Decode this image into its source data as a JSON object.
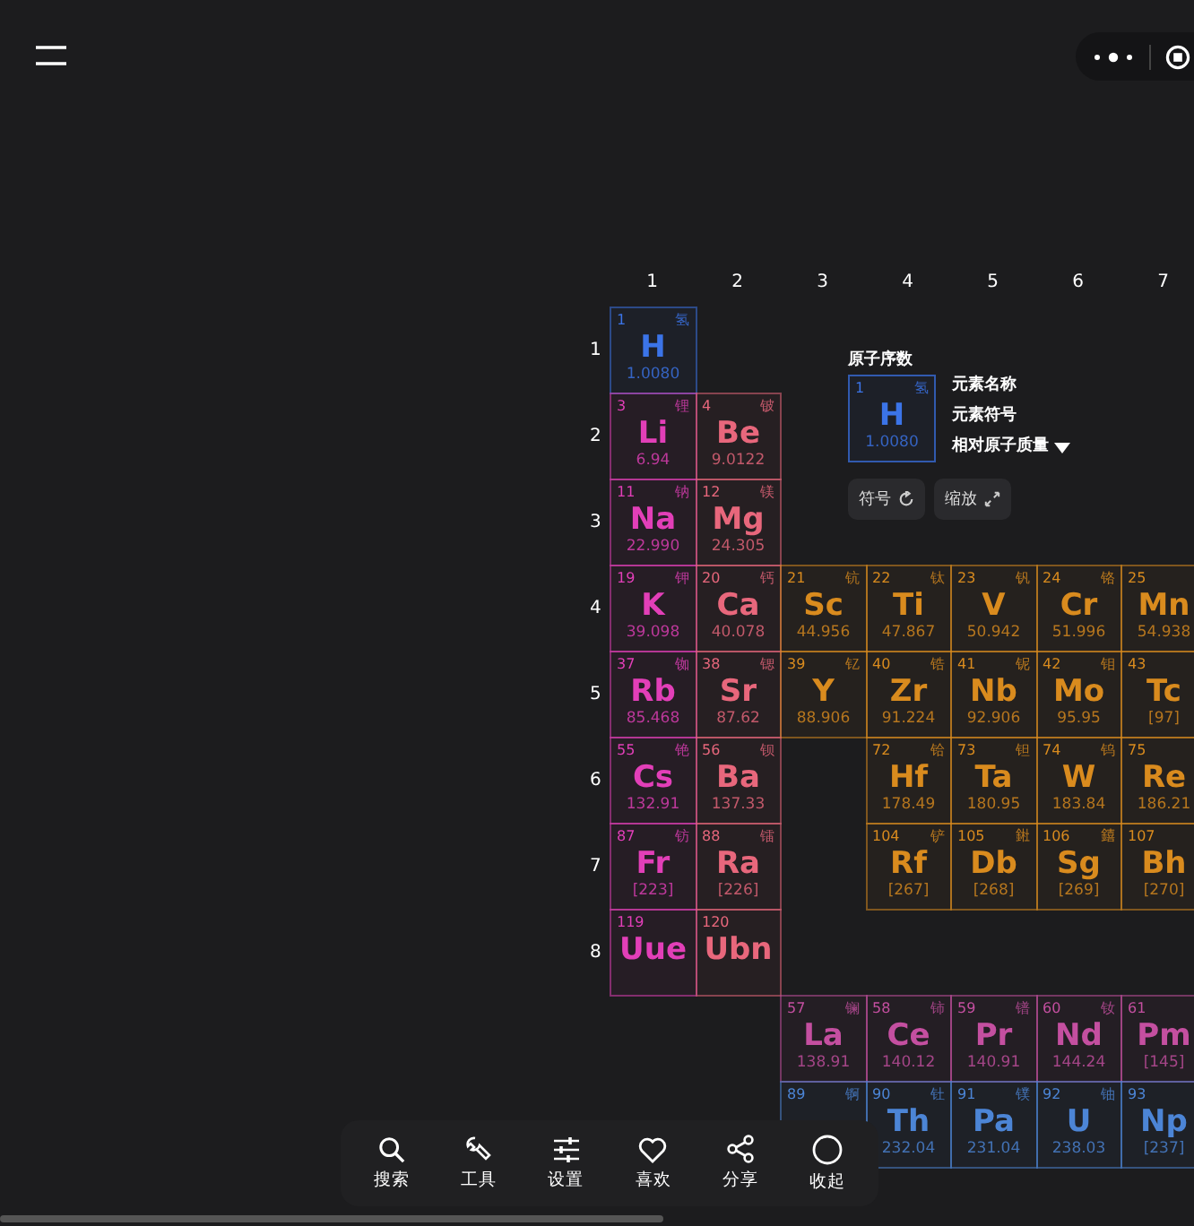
{
  "group_headers": [
    "1",
    "2",
    "3",
    "4",
    "5",
    "6",
    "7"
  ],
  "rows": [
    {
      "label": "1",
      "cells": [
        {
          "kind": "element",
          "number": "1",
          "name": "氢",
          "symbol": "H",
          "mass": "1.0080",
          "color": "#3b74e8"
        }
      ]
    },
    {
      "label": "2",
      "cells": [
        {
          "kind": "element",
          "number": "3",
          "name": "锂",
          "symbol": "Li",
          "mass": "6.94",
          "color": "#e23fb8"
        },
        {
          "kind": "element",
          "number": "4",
          "name": "铍",
          "symbol": "Be",
          "mass": "9.0122",
          "color": "#e8677c"
        }
      ]
    },
    {
      "label": "3",
      "cells": [
        {
          "kind": "element",
          "number": "11",
          "name": "钠",
          "symbol": "Na",
          "mass": "22.990",
          "color": "#e23fb8"
        },
        {
          "kind": "element",
          "number": "12",
          "name": "镁",
          "symbol": "Mg",
          "mass": "24.305",
          "color": "#e8677c"
        }
      ]
    },
    {
      "label": "4",
      "cells": [
        {
          "kind": "element",
          "number": "19",
          "name": "钾",
          "symbol": "K",
          "mass": "39.098",
          "color": "#e23fb8"
        },
        {
          "kind": "element",
          "number": "20",
          "name": "钙",
          "symbol": "Ca",
          "mass": "40.078",
          "color": "#e8677c"
        },
        {
          "kind": "element",
          "number": "21",
          "name": "钪",
          "symbol": "Sc",
          "mass": "44.956",
          "color": "#d98b1e"
        },
        {
          "kind": "element",
          "number": "22",
          "name": "钛",
          "symbol": "Ti",
          "mass": "47.867",
          "color": "#d98b1e"
        },
        {
          "kind": "element",
          "number": "23",
          "name": "钒",
          "symbol": "V",
          "mass": "50.942",
          "color": "#d98b1e"
        },
        {
          "kind": "element",
          "number": "24",
          "name": "铬",
          "symbol": "Cr",
          "mass": "51.996",
          "color": "#d98b1e"
        },
        {
          "kind": "element",
          "number": "25",
          "symbol": "Mn",
          "mass": "54.938",
          "color": "#d98b1e"
        }
      ]
    },
    {
      "label": "5",
      "cells": [
        {
          "kind": "element",
          "number": "37",
          "name": "铷",
          "symbol": "Rb",
          "mass": "85.468",
          "color": "#e23fb8"
        },
        {
          "kind": "element",
          "number": "38",
          "name": "锶",
          "symbol": "Sr",
          "mass": "87.62",
          "color": "#e8677c"
        },
        {
          "kind": "element",
          "number": "39",
          "name": "钇",
          "symbol": "Y",
          "mass": "88.906",
          "color": "#d98b1e"
        },
        {
          "kind": "element",
          "number": "40",
          "name": "锆",
          "symbol": "Zr",
          "mass": "91.224",
          "color": "#d98b1e"
        },
        {
          "kind": "element",
          "number": "41",
          "name": "铌",
          "symbol": "Nb",
          "mass": "92.906",
          "color": "#d98b1e"
        },
        {
          "kind": "element",
          "number": "42",
          "name": "钼",
          "symbol": "Mo",
          "mass": "95.95",
          "color": "#d98b1e"
        },
        {
          "kind": "element",
          "number": "43",
          "symbol": "Tc",
          "mass": "[97]",
          "color": "#d98b1e"
        }
      ]
    },
    {
      "label": "6",
      "cells": [
        {
          "kind": "element",
          "number": "55",
          "name": "铯",
          "symbol": "Cs",
          "mass": "132.91",
          "color": "#e23fb8"
        },
        {
          "kind": "element",
          "number": "56",
          "name": "钡",
          "symbol": "Ba",
          "mass": "137.33",
          "color": "#e8677c"
        },
        {
          "kind": "empty"
        },
        {
          "kind": "element",
          "number": "72",
          "name": "铪",
          "symbol": "Hf",
          "mass": "178.49",
          "color": "#d98b1e"
        },
        {
          "kind": "element",
          "number": "73",
          "name": "钽",
          "symbol": "Ta",
          "mass": "180.95",
          "color": "#d98b1e"
        },
        {
          "kind": "element",
          "number": "74",
          "name": "钨",
          "symbol": "W",
          "mass": "183.84",
          "color": "#d98b1e"
        },
        {
          "kind": "element",
          "number": "75",
          "symbol": "Re",
          "mass": "186.21",
          "color": "#d98b1e"
        }
      ]
    },
    {
      "label": "7",
      "cells": [
        {
          "kind": "element",
          "number": "87",
          "name": "钫",
          "symbol": "Fr",
          "mass": "[223]",
          "color": "#e23fb8"
        },
        {
          "kind": "element",
          "number": "88",
          "name": "镭",
          "symbol": "Ra",
          "mass": "[226]",
          "color": "#e8677c"
        },
        {
          "kind": "empty"
        },
        {
          "kind": "element",
          "number": "104",
          "name": "铲",
          "symbol": "Rf",
          "mass": "[267]",
          "color": "#d98b1e"
        },
        {
          "kind": "element",
          "number": "105",
          "name": "𨧀",
          "symbol": "Db",
          "mass": "[268]",
          "color": "#d98b1e"
        },
        {
          "kind": "element",
          "number": "106",
          "name": "𨭎",
          "symbol": "Sg",
          "mass": "[269]",
          "color": "#d98b1e"
        },
        {
          "kind": "element",
          "number": "107",
          "symbol": "Bh",
          "mass": "[270]",
          "color": "#d98b1e"
        }
      ]
    },
    {
      "label": "8",
      "cells": [
        {
          "kind": "element",
          "number": "119",
          "symbol": "Uue",
          "color": "#e23fb8"
        },
        {
          "kind": "element",
          "number": "120",
          "symbol": "Ubn",
          "color": "#e8677c"
        }
      ]
    },
    {
      "cells": [
        {
          "kind": "empty"
        },
        {
          "kind": "empty"
        },
        {
          "kind": "element",
          "number": "57",
          "name": "镧",
          "symbol": "La",
          "mass": "138.91",
          "color": "#c44fa0"
        },
        {
          "kind": "element",
          "number": "58",
          "name": "铈",
          "symbol": "Ce",
          "mass": "140.12",
          "color": "#c44fa0"
        },
        {
          "kind": "element",
          "number": "59",
          "name": "镨",
          "symbol": "Pr",
          "mass": "140.91",
          "color": "#c44fa0"
        },
        {
          "kind": "element",
          "number": "60",
          "name": "钕",
          "symbol": "Nd",
          "mass": "144.24",
          "color": "#c44fa0"
        },
        {
          "kind": "element",
          "number": "61",
          "symbol": "Pm",
          "mass": "[145]",
          "color": "#c44fa0"
        }
      ]
    },
    {
      "cells": [
        {
          "kind": "empty"
        },
        {
          "kind": "empty"
        },
        {
          "kind": "element",
          "number": "89",
          "name": "锕",
          "color": "#4c85d6"
        },
        {
          "kind": "element",
          "number": "90",
          "name": "钍",
          "symbol": "Th",
          "mass": "232.04",
          "color": "#4c85d6"
        },
        {
          "kind": "element",
          "number": "91",
          "name": "镤",
          "symbol": "Pa",
          "mass": "231.04",
          "color": "#4c85d6"
        },
        {
          "kind": "element",
          "number": "92",
          "name": "铀",
          "symbol": "U",
          "mass": "238.03",
          "color": "#4c85d6"
        },
        {
          "kind": "element",
          "number": "93",
          "symbol": "Np",
          "mass": "[237]",
          "color": "#4c85d6"
        }
      ]
    }
  ],
  "legend": {
    "title": "原子序数",
    "sample": {
      "number": "1",
      "name": "氢",
      "symbol": "H",
      "mass": "1.0080",
      "color": "#3b74e8"
    },
    "labels": [
      "元素名称",
      "元素符号"
    ],
    "mass_label": "相对原子质量",
    "buttons": [
      {
        "label": "符号",
        "kind": "refresh"
      },
      {
        "label": "缩放",
        "kind": "expand"
      }
    ]
  },
  "toolbar": [
    {
      "label": "搜索",
      "kind": "search"
    },
    {
      "label": "工具",
      "kind": "wrench"
    },
    {
      "label": "设置",
      "kind": "sliders"
    },
    {
      "label": "喜欢",
      "kind": "heart"
    },
    {
      "label": "分享",
      "kind": "share"
    },
    {
      "label": "收起",
      "kind": "circle"
    }
  ]
}
